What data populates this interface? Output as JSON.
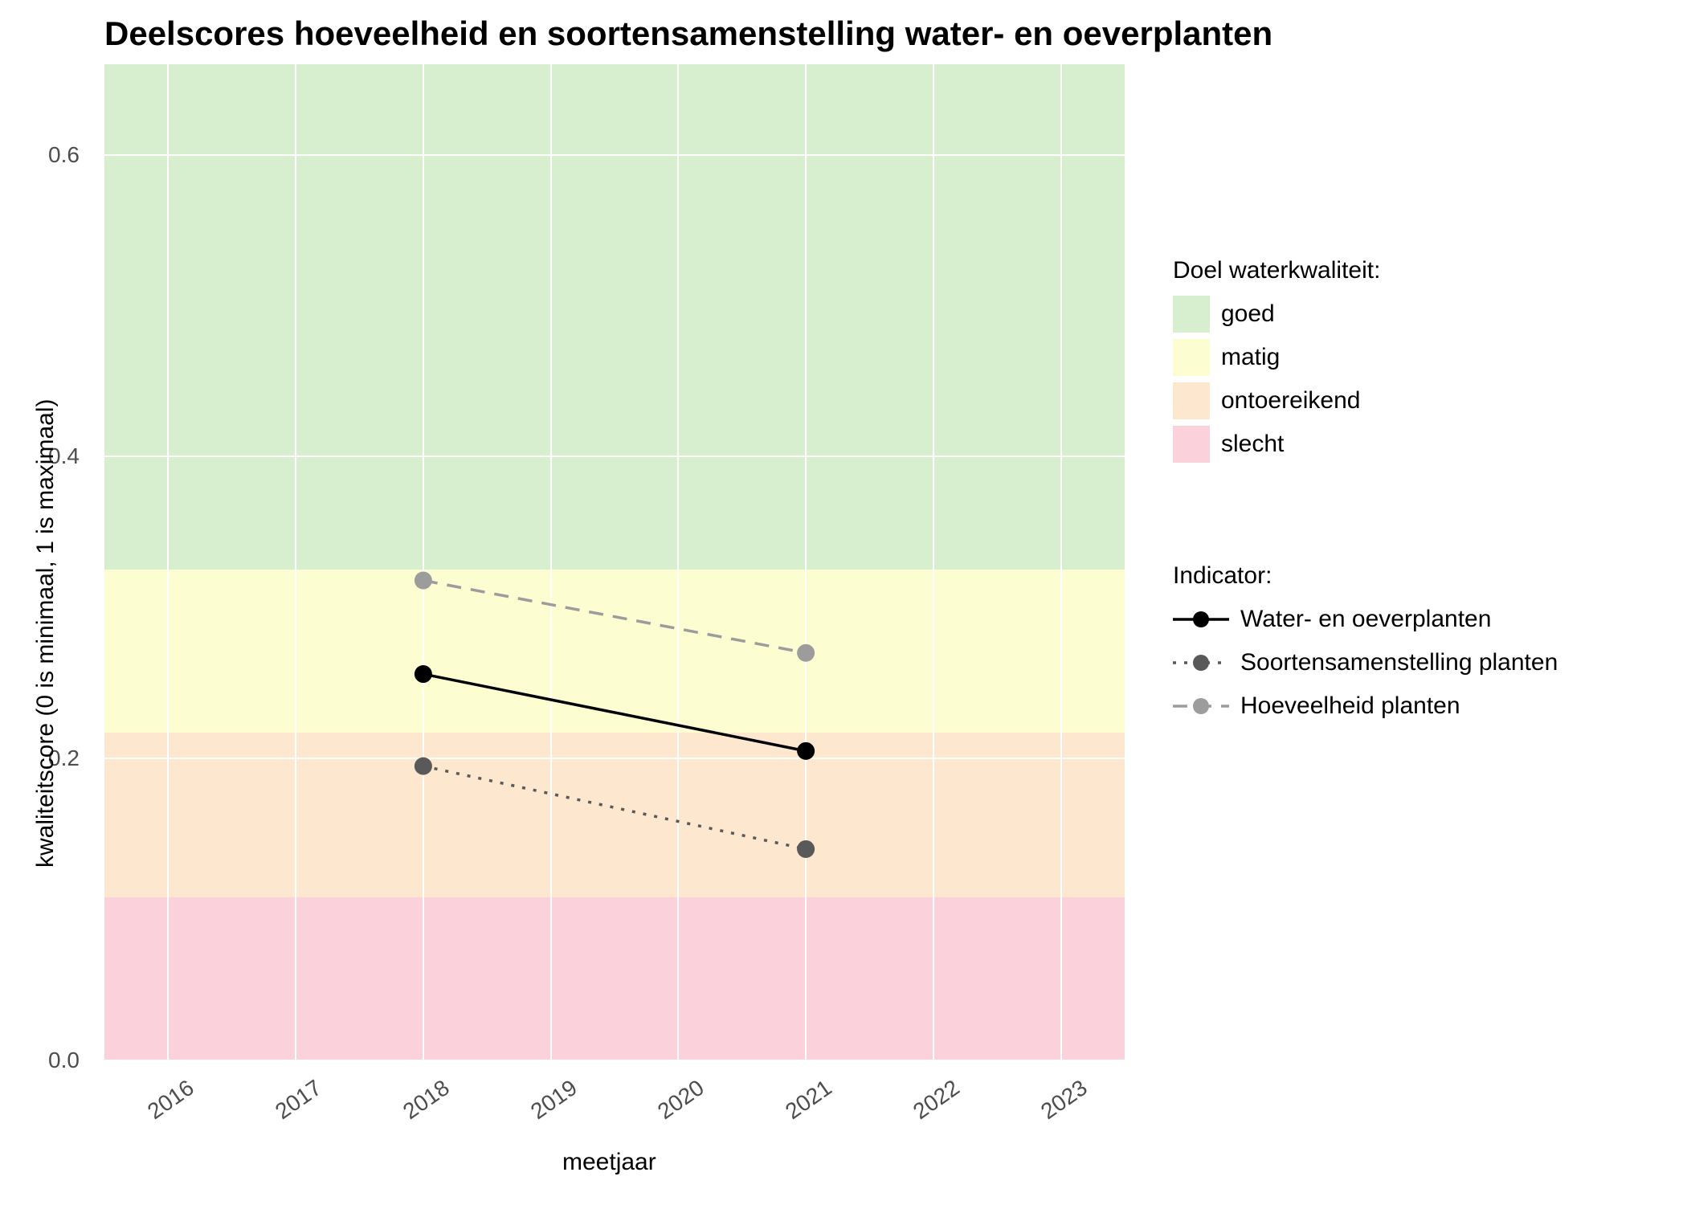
{
  "chart_data": {
    "type": "line",
    "title": "Deelscores hoeveelheid en soortensamenstelling water- en oeverplanten",
    "xlabel": "meetjaar",
    "ylabel": "kwaliteitscore (0 is minimaal, 1 is maximaal)",
    "x_ticks": [
      2016,
      2017,
      2018,
      2019,
      2020,
      2021,
      2022,
      2023
    ],
    "y_ticks": [
      0.0,
      0.2,
      0.4,
      0.6
    ],
    "xlim": [
      2015.5,
      2023.5
    ],
    "ylim": [
      0.0,
      0.66
    ],
    "bands": {
      "title": "Doel waterkwaliteit:",
      "levels": [
        {
          "name": "goed",
          "from": 0.325,
          "to": 0.66,
          "color": "#d7efce"
        },
        {
          "name": "matig",
          "from": 0.217,
          "to": 0.325,
          "color": "#fdfdd2"
        },
        {
          "name": "ontoereikend",
          "from": 0.108,
          "to": 0.217,
          "color": "#fde7ce"
        },
        {
          "name": "slecht",
          "from": 0.0,
          "to": 0.108,
          "color": "#fbd1db"
        }
      ]
    },
    "series_legend_title": "Indicator:",
    "x": [
      2018,
      2021
    ],
    "series": [
      {
        "name": "Water- en oeverplanten",
        "values": [
          0.256,
          0.205
        ],
        "color": "#000000",
        "dash": "solid"
      },
      {
        "name": "Soortensamenstelling planten",
        "values": [
          0.195,
          0.14
        ],
        "color": "#595959",
        "dash": "dotted"
      },
      {
        "name": "Hoeveelheid planten",
        "values": [
          0.318,
          0.27
        ],
        "color": "#9c9c9c",
        "dash": "dashed"
      }
    ]
  }
}
